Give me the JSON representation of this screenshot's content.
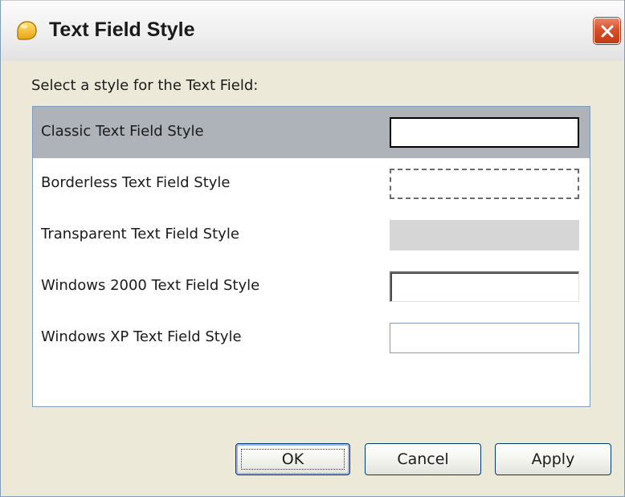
{
  "window": {
    "title": "Text Field Style"
  },
  "prompt": "Select a style for the Text Field:",
  "styles": [
    {
      "label": "Classic Text Field Style",
      "selected": true
    },
    {
      "label": "Borderless Text Field Style",
      "selected": false
    },
    {
      "label": "Transparent Text Field Style",
      "selected": false
    },
    {
      "label": "Windows 2000 Text Field Style",
      "selected": false
    },
    {
      "label": "Windows XP Text Field Style",
      "selected": false
    }
  ],
  "buttons": {
    "ok": "OK",
    "cancel": "Cancel",
    "apply": "Apply"
  },
  "icons": {
    "app": "app-icon",
    "close": "close-icon"
  },
  "colors": {
    "selection": "#aeb3ba",
    "close_button": "#d5502c",
    "list_border": "#7f9db9"
  }
}
